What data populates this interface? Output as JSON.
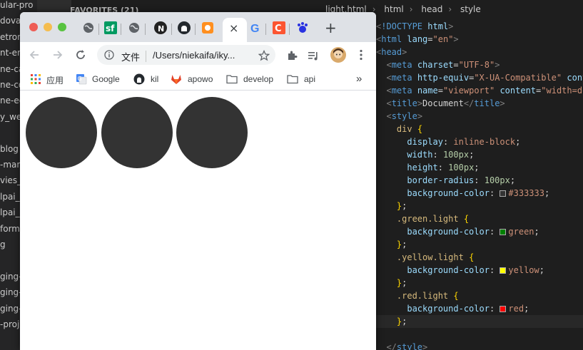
{
  "window_title": "Document",
  "favorites_label": "FAVORITES (21)",
  "sidebar_files": [
    "ular-pro",
    "dova-",
    "etron",
    "nt-eng",
    "ne-ca",
    "ne-co",
    "ne-ed",
    "y_web",
    "",
    "blog",
    "-mana",
    "vies_c",
    "lpai_",
    "lpai_",
    "form",
    "g",
    "",
    "ging-",
    "ging-",
    "ging-",
    "-proj"
  ],
  "breadcrumb": [
    "light.html",
    "html",
    "head",
    "style"
  ],
  "browser": {
    "new_tab_label": "+",
    "close_tab_label": "×",
    "address_label": "文件",
    "address_url": "/Users/niekaifa/iky...",
    "bookmarks": [
      "应用",
      "Google",
      "kil",
      "apowo",
      "develop",
      "api"
    ],
    "more_bookmarks": "»"
  },
  "page": {
    "lights": [
      {
        "class": "",
        "color": "#333333"
      },
      {
        "class": "",
        "color": "#333333"
      },
      {
        "class": "",
        "color": "#333333"
      }
    ]
  },
  "code_lines": [
    {
      "html": "<span class=\"pu\">&lt;</span><span class=\"tg\">!DOCTYPE</span> <span class=\"at\">html</span><span class=\"pu\">&gt;</span>"
    },
    {
      "html": "<span class=\"pu\">&lt;</span><span class=\"tg\">html</span> <span class=\"at\">lang</span>=<span class=\"st\">\"en\"</span><span class=\"pu\">&gt;</span>"
    },
    {
      "html": "<span class=\"pu\">&lt;</span><span class=\"tg\">head</span><span class=\"pu\">&gt;</span>"
    },
    {
      "html": "  <span class=\"pu\">&lt;</span><span class=\"tg\">meta</span> <span class=\"at\">charset</span>=<span class=\"st\">\"UTF-8\"</span><span class=\"pu\">&gt;</span>"
    },
    {
      "html": "  <span class=\"pu\">&lt;</span><span class=\"tg\">meta</span> <span class=\"at\">http-equiv</span>=<span class=\"st\">\"X-UA-Compatible\"</span> <span class=\"at\">cont</span>"
    },
    {
      "html": "  <span class=\"pu\">&lt;</span><span class=\"tg\">meta</span> <span class=\"at\">name</span>=<span class=\"st\">\"viewport\"</span> <span class=\"at\">content</span>=<span class=\"st\">\"width=de</span>"
    },
    {
      "html": "  <span class=\"pu\">&lt;</span><span class=\"tg\">title</span><span class=\"pu\">&gt;</span>Document<span class=\"pu\">&lt;/</span><span class=\"tg\">title</span><span class=\"pu\">&gt;</span>"
    },
    {
      "html": "  <span class=\"pu\">&lt;</span><span class=\"tg\">style</span><span class=\"pu\">&gt;</span>"
    },
    {
      "html": "    <span class=\"sel\">div</span> <span class=\"br\">{</span>"
    },
    {
      "html": "      <span class=\"pr\">display</span>: <span class=\"vl\">inline-block</span>;"
    },
    {
      "html": "      <span class=\"pr\">width</span>: <span class=\"nm\">100px</span>;"
    },
    {
      "html": "      <span class=\"pr\">height</span>: <span class=\"nm\">100px</span>;"
    },
    {
      "html": "      <span class=\"pr\">border-radius</span>: <span class=\"nm\">100px</span>;"
    },
    {
      "html": "      <span class=\"pr\">background-color</span>: <span class=\"sw\" style=\"background:#333333\"></span><span class=\"vl\">#333333</span>;"
    },
    {
      "html": "    <span class=\"br\">}</span>;"
    },
    {
      "html": "    <span class=\"sel\">.green.light</span> <span class=\"br\">{</span>"
    },
    {
      "html": "      <span class=\"pr\">background-color</span>: <span class=\"sw\" style=\"background:green\"></span><span class=\"vl\">green</span>;"
    },
    {
      "html": "    <span class=\"br\">}</span>;"
    },
    {
      "html": "    <span class=\"sel\">.yellow.light</span> <span class=\"br\">{</span>"
    },
    {
      "html": "      <span class=\"pr\">background-color</span>: <span class=\"sw\" style=\"background:yellow\"></span><span class=\"vl\">yellow</span>;"
    },
    {
      "html": "    <span class=\"br\">}</span>;"
    },
    {
      "html": "    <span class=\"sel\">.red.light</span> <span class=\"br\">{</span>"
    },
    {
      "html": "      <span class=\"pr\">background-color</span>: <span class=\"sw\" style=\"background:red\"></span><span class=\"vl\">red</span>;"
    },
    {
      "html": "    <span class=\"br\">}</span>;"
    },
    {
      "html": ""
    },
    {
      "html": "  <span class=\"pu\">&lt;/</span><span class=\"tg\">style</span><span class=\"pu\">&gt;</span>"
    }
  ]
}
